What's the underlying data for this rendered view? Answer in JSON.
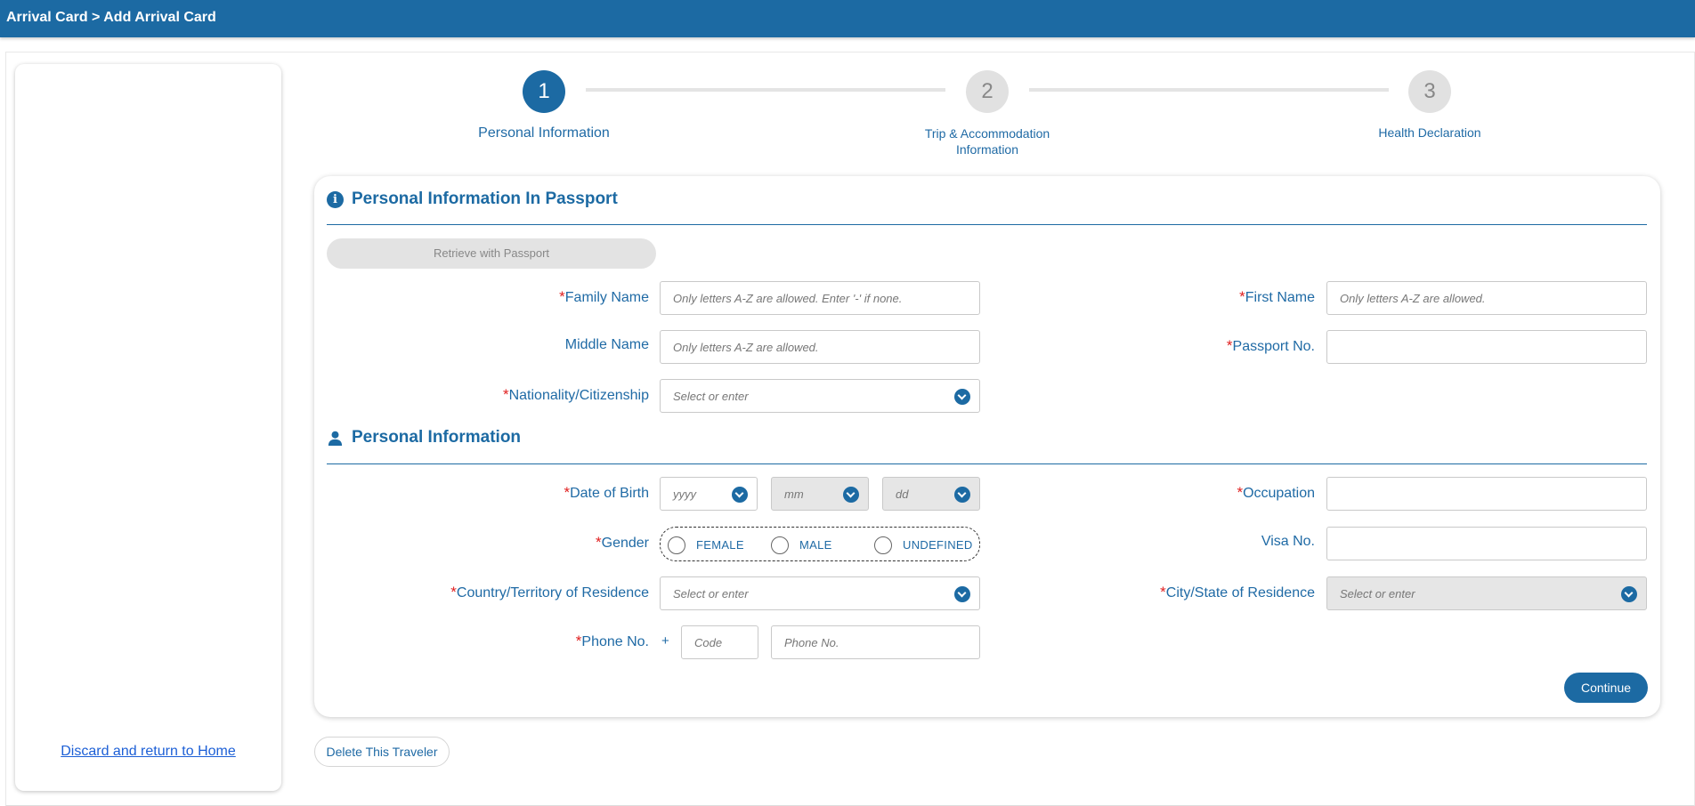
{
  "header": {
    "breadcrumb": "Arrival Card > Add Arrival Card"
  },
  "sidebar": {
    "discard_link": "Discard and return to Home"
  },
  "stepper": {
    "steps": [
      {
        "number": "1",
        "label": "Personal Information",
        "state": "active"
      },
      {
        "number": "2",
        "label_line1": "Trip & Accommodation",
        "label_line2": "Information",
        "state": "inactive"
      },
      {
        "number": "3",
        "label": "Health Declaration",
        "state": "inactive"
      }
    ]
  },
  "passport_section": {
    "title": "Personal Information In Passport",
    "icon": "info-icon",
    "retrieve_button": "Retrieve with Passport",
    "family_name": {
      "label": "Family Name",
      "required": "*",
      "placeholder": "Only letters A-Z are allowed. Enter '-' if none."
    },
    "first_name": {
      "label": "First Name",
      "required": "*",
      "placeholder": "Only letters A-Z are allowed."
    },
    "middle_name": {
      "label": "Middle Name",
      "placeholder": "Only letters A-Z are allowed."
    },
    "passport_no": {
      "label": "Passport No.",
      "required": "*",
      "placeholder": ""
    },
    "nationality": {
      "label": "Nationality/Citizenship",
      "required": "*",
      "placeholder": "Select or enter"
    }
  },
  "personal_section": {
    "title": "Personal Information",
    "icon": "person-icon",
    "dob": {
      "label": "Date of Birth",
      "required": "*",
      "year": "yyyy",
      "month": "mm",
      "day": "dd"
    },
    "occupation": {
      "label": "Occupation",
      "required": "*",
      "placeholder": ""
    },
    "gender": {
      "label": "Gender",
      "required": "*",
      "options": [
        "FEMALE",
        "MALE",
        "UNDEFINED"
      ]
    },
    "visa_no": {
      "label": "Visa No.",
      "placeholder": ""
    },
    "country_residence": {
      "label": "Country/Territory of Residence",
      "required": "*",
      "placeholder": "Select or enter"
    },
    "city_residence": {
      "label": "City/State of Residence",
      "required": "*",
      "placeholder": "Select or enter"
    },
    "phone": {
      "label": "Phone No.",
      "required": "*",
      "plus": "+",
      "code_placeholder": "Code",
      "number_placeholder": "Phone No."
    }
  },
  "actions": {
    "continue": "Continue",
    "delete_traveler": "Delete This Traveler"
  },
  "colors": {
    "primary": "#1c6aa3",
    "required": "#e02020",
    "link": "#1c5fd6"
  }
}
